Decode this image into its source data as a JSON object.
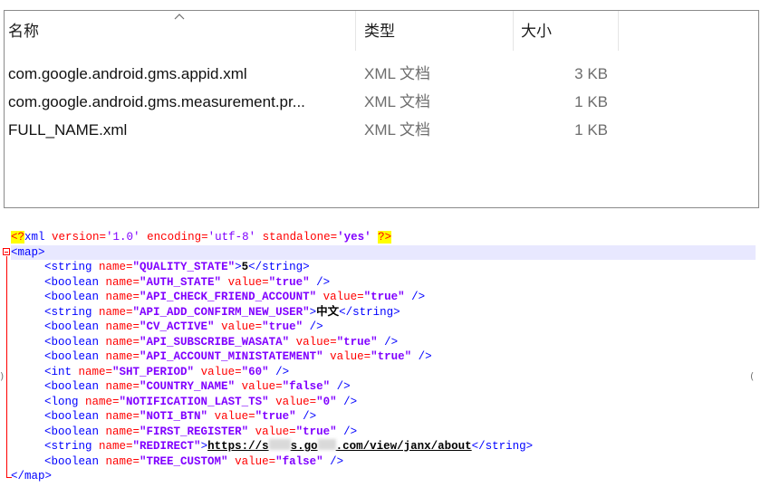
{
  "explorer": {
    "columns": {
      "name": "名称",
      "type": "类型",
      "size": "大小"
    },
    "files": [
      {
        "name": "com.google.android.gms.appid.xml",
        "type": "XML 文档",
        "size": "3 KB"
      },
      {
        "name": "com.google.android.gms.measurement.pr...",
        "type": "XML 文档",
        "size": "1 KB"
      },
      {
        "name": "FULL_NAME.xml",
        "type": "XML 文档",
        "size": "1 KB"
      }
    ]
  },
  "editor": {
    "declaration": {
      "open": "<?",
      "name": "xml",
      "attrs": [
        {
          "name": " version=",
          "value": "'1.0'"
        },
        {
          "name": " encoding=",
          "value": "'utf-8'"
        },
        {
          "name": " standalone=",
          "value": "'yes'"
        }
      ],
      "close": "?>"
    },
    "root_open": "<map>",
    "root_close": "</map>",
    "entries": [
      {
        "tag": "string",
        "name": "\"QUALITY_STATE\"",
        "text": "5"
      },
      {
        "tag": "boolean",
        "name": "\"AUTH_STATE\"",
        "value": "\"true\""
      },
      {
        "tag": "boolean",
        "name": "\"API_CHECK_FRIEND_ACCOUNT\"",
        "value": "\"true\""
      },
      {
        "tag": "string",
        "name": "\"API_ADD_CONFIRM_NEW_USER\"",
        "text": "中文"
      },
      {
        "tag": "boolean",
        "name": "\"CV_ACTIVE\"",
        "value": "\"true\""
      },
      {
        "tag": "boolean",
        "name": "\"API_SUBSCRIBE_WASATA\"",
        "value": "\"true\""
      },
      {
        "tag": "boolean",
        "name": "\"API_ACCOUNT_MINISTATEMENT\"",
        "value": "\"true\""
      },
      {
        "tag": "int",
        "name": "\"SHT_PERIOD\"",
        "value": "\"60\""
      },
      {
        "tag": "boolean",
        "name": "\"COUNTRY_NAME\"",
        "value": "\"false\""
      },
      {
        "tag": "long",
        "name": "\"NOTIFICATION_LAST_TS\"",
        "value": "\"0\""
      },
      {
        "tag": "boolean",
        "name": "\"NOTI_BTN\"",
        "value": "\"true\""
      },
      {
        "tag": "boolean",
        "name": "\"FIRST_REGISTER\"",
        "value": "\"true\""
      },
      {
        "tag": "string",
        "name": "\"REDIRECT\"",
        "url": {
          "p1": "https://s",
          "p2": "s.go",
          "p3": ".com/view/janx/about"
        }
      },
      {
        "tag": "boolean",
        "name": "\"TREE_CUSTOM\"",
        "value": "\"false\""
      }
    ],
    "markers": {
      "left": ")",
      "right": "("
    }
  }
}
